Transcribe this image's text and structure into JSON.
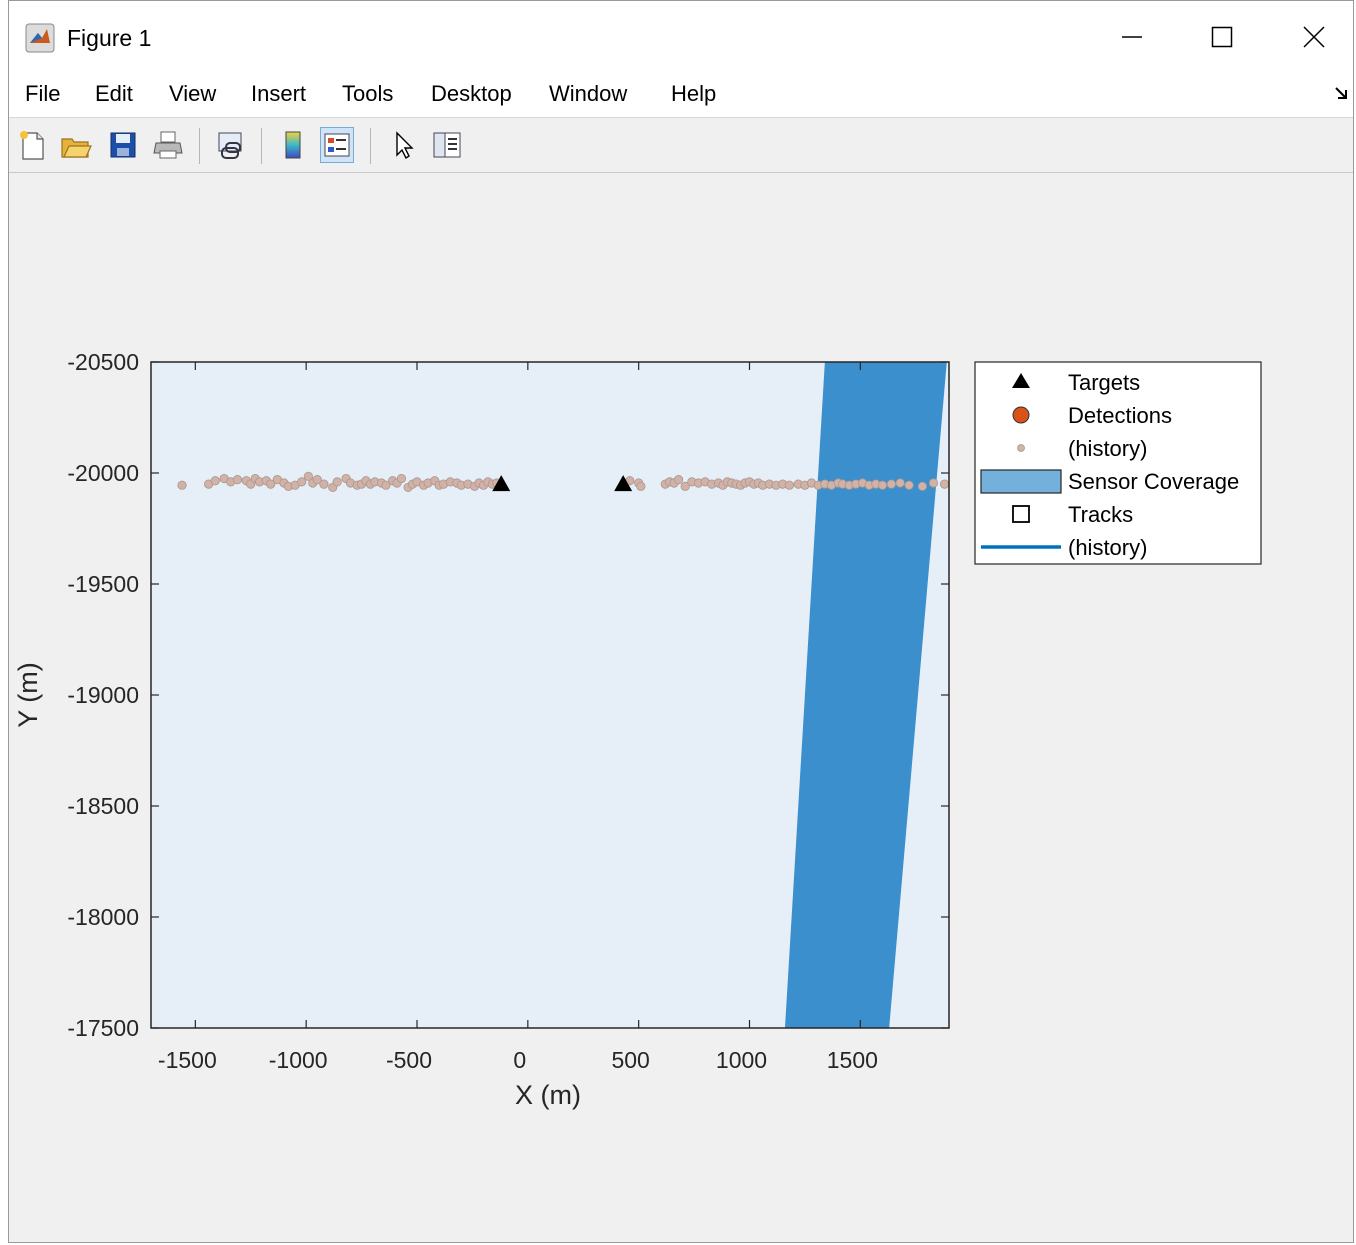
{
  "window": {
    "title": "Figure 1",
    "minimize_label": "–",
    "maximize_label": "☐",
    "close_label": "✕"
  },
  "menu": [
    "File",
    "Edit",
    "View",
    "Insert",
    "Tools",
    "Desktop",
    "Window",
    "Help"
  ],
  "toolbar": {
    "buttons": [
      {
        "icon": "new-figure-icon"
      },
      {
        "icon": "open-file-icon"
      },
      {
        "icon": "save-icon"
      },
      {
        "icon": "print-icon"
      },
      {
        "icon": "link-plot-icon"
      },
      {
        "icon": "colorbar-icon"
      },
      {
        "icon": "legend-icon",
        "active": true
      },
      {
        "icon": "edit-plot-pointer-icon"
      },
      {
        "icon": "property-inspector-icon"
      }
    ]
  },
  "chart_data": {
    "type": "scatter",
    "xlabel": "X (m)",
    "ylabel": "Y (m)",
    "xlim": [
      -1700,
      1900
    ],
    "ylim": [
      -20500,
      -17500
    ],
    "y_reversed": true,
    "xticks": [
      -1500,
      -1000,
      -500,
      0,
      500,
      1000,
      1500
    ],
    "yticks": [
      -20500,
      -20000,
      -19500,
      -19000,
      -18500,
      -18000,
      -17500
    ],
    "xtick_labels": [
      "-1500",
      "-1000",
      "-500",
      "0",
      "500",
      "1000",
      "1500"
    ],
    "ytick_labels": [
      "-20500",
      "-20000",
      "-19500",
      "-19000",
      "-18500",
      "-18000",
      "-17500"
    ],
    "legend": {
      "placement": "outside-right",
      "entries": [
        {
          "label": "Targets",
          "marker": "triangle"
        },
        {
          "label": "Detections",
          "marker": "circle"
        },
        {
          "label": "(history)",
          "marker": "small-circle"
        },
        {
          "label": "Sensor Coverage",
          "marker": "patch"
        },
        {
          "label": "Tracks",
          "marker": "square"
        },
        {
          "label": "(history)",
          "marker": "line"
        }
      ]
    },
    "colors": {
      "axes_background": "#e6eff8",
      "coverage": "#3a8fcc",
      "coverage_legend": "#74b0dc",
      "history": "#d2b2a6",
      "history_edge": "#a89690",
      "detection": "#d95319",
      "target": "#000000",
      "track_history": "#0072bd"
    },
    "series": [
      {
        "name": "Targets",
        "points": [
          {
            "x": -120,
            "y": -19950
          },
          {
            "x": 430,
            "y": -19950
          }
        ]
      },
      {
        "name": "(history)",
        "points": [
          {
            "x": -1560,
            "y": -19945
          },
          {
            "x": -1440,
            "y": -19950
          },
          {
            "x": -1410,
            "y": -19965
          },
          {
            "x": -1370,
            "y": -19975
          },
          {
            "x": -1340,
            "y": -19960
          },
          {
            "x": -1310,
            "y": -19970
          },
          {
            "x": -1270,
            "y": -19965
          },
          {
            "x": -1250,
            "y": -19950
          },
          {
            "x": -1230,
            "y": -19975
          },
          {
            "x": -1210,
            "y": -19960
          },
          {
            "x": -1180,
            "y": -19965
          },
          {
            "x": -1160,
            "y": -19950
          },
          {
            "x": -1130,
            "y": -19970
          },
          {
            "x": -1100,
            "y": -19955
          },
          {
            "x": -1080,
            "y": -19940
          },
          {
            "x": -1050,
            "y": -19945
          },
          {
            "x": -1020,
            "y": -19960
          },
          {
            "x": -990,
            "y": -19985
          },
          {
            "x": -970,
            "y": -19955
          },
          {
            "x": -950,
            "y": -19970
          },
          {
            "x": -920,
            "y": -19950
          },
          {
            "x": -880,
            "y": -19935
          },
          {
            "x": -860,
            "y": -19960
          },
          {
            "x": -820,
            "y": -19975
          },
          {
            "x": -800,
            "y": -19955
          },
          {
            "x": -770,
            "y": -19945
          },
          {
            "x": -750,
            "y": -19950
          },
          {
            "x": -730,
            "y": -19965
          },
          {
            "x": -710,
            "y": -19950
          },
          {
            "x": -690,
            "y": -19960
          },
          {
            "x": -660,
            "y": -19955
          },
          {
            "x": -640,
            "y": -19945
          },
          {
            "x": -610,
            "y": -19965
          },
          {
            "x": -590,
            "y": -19955
          },
          {
            "x": -570,
            "y": -19975
          },
          {
            "x": -540,
            "y": -19935
          },
          {
            "x": -520,
            "y": -19950
          },
          {
            "x": -500,
            "y": -19960
          },
          {
            "x": -470,
            "y": -19945
          },
          {
            "x": -450,
            "y": -19955
          },
          {
            "x": -420,
            "y": -19965
          },
          {
            "x": -400,
            "y": -19945
          },
          {
            "x": -380,
            "y": -19950
          },
          {
            "x": -350,
            "y": -19960
          },
          {
            "x": -320,
            "y": -19955
          },
          {
            "x": -300,
            "y": -19945
          },
          {
            "x": -270,
            "y": -19950
          },
          {
            "x": -240,
            "y": -19940
          },
          {
            "x": -220,
            "y": -19955
          },
          {
            "x": -200,
            "y": -19945
          },
          {
            "x": -180,
            "y": -19960
          },
          {
            "x": -160,
            "y": -19950
          },
          {
            "x": -140,
            "y": -19955
          },
          {
            "x": 460,
            "y": -19965
          },
          {
            "x": 500,
            "y": -19955
          },
          {
            "x": 510,
            "y": -19940
          },
          {
            "x": 620,
            "y": -19950
          },
          {
            "x": 640,
            "y": -19960
          },
          {
            "x": 660,
            "y": -19955
          },
          {
            "x": 680,
            "y": -19970
          },
          {
            "x": 710,
            "y": -19940
          },
          {
            "x": 740,
            "y": -19960
          },
          {
            "x": 770,
            "y": -19955
          },
          {
            "x": 800,
            "y": -19960
          },
          {
            "x": 830,
            "y": -19950
          },
          {
            "x": 860,
            "y": -19955
          },
          {
            "x": 880,
            "y": -19945
          },
          {
            "x": 900,
            "y": -19960
          },
          {
            "x": 920,
            "y": -19955
          },
          {
            "x": 940,
            "y": -19950
          },
          {
            "x": 960,
            "y": -19945
          },
          {
            "x": 980,
            "y": -19955
          },
          {
            "x": 1000,
            "y": -19960
          },
          {
            "x": 1020,
            "y": -19950
          },
          {
            "x": 1040,
            "y": -19955
          },
          {
            "x": 1060,
            "y": -19945
          },
          {
            "x": 1090,
            "y": -19950
          },
          {
            "x": 1120,
            "y": -19945
          },
          {
            "x": 1150,
            "y": -19950
          },
          {
            "x": 1180,
            "y": -19945
          },
          {
            "x": 1220,
            "y": -19950
          },
          {
            "x": 1250,
            "y": -19945
          },
          {
            "x": 1280,
            "y": -19955
          },
          {
            "x": 1310,
            "y": -19945
          },
          {
            "x": 1340,
            "y": -19950
          },
          {
            "x": 1370,
            "y": -19945
          },
          {
            "x": 1400,
            "y": -19955
          },
          {
            "x": 1420,
            "y": -19950
          },
          {
            "x": 1450,
            "y": -19945
          },
          {
            "x": 1480,
            "y": -19950
          },
          {
            "x": 1510,
            "y": -19955
          },
          {
            "x": 1540,
            "y": -19945
          },
          {
            "x": 1570,
            "y": -19950
          },
          {
            "x": 1600,
            "y": -19945
          },
          {
            "x": 1640,
            "y": -19950
          },
          {
            "x": 1680,
            "y": -19955
          },
          {
            "x": 1720,
            "y": -19945
          },
          {
            "x": 1780,
            "y": -19940
          },
          {
            "x": 1830,
            "y": -19955
          },
          {
            "x": 1880,
            "y": -19950
          }
        ]
      },
      {
        "name": "Sensor Coverage",
        "polygon": [
          {
            "x": 1340,
            "y": -20500
          },
          {
            "x": 1890,
            "y": -20500
          },
          {
            "x": 1630,
            "y": -17500
          },
          {
            "x": 1160,
            "y": -17500
          }
        ]
      }
    ]
  }
}
